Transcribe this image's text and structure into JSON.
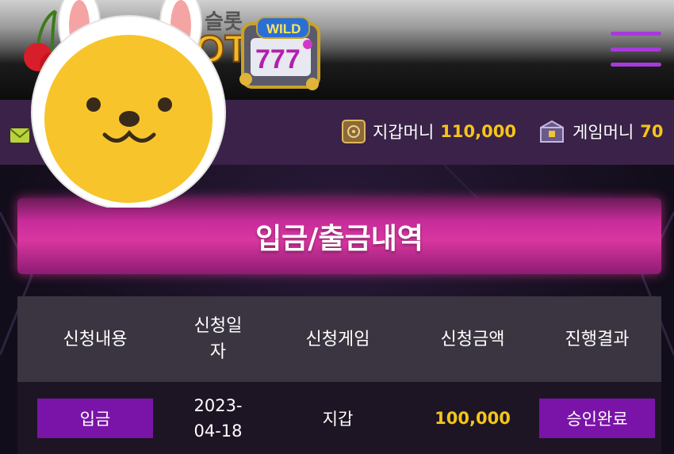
{
  "header": {
    "logo_label": "슬롯",
    "logo_badge": "WILD",
    "logo_reels": "777"
  },
  "infobar": {
    "wallet_label": "지갑머니",
    "wallet_amount": "110,000",
    "game_label": "게임머니",
    "game_amount": "70"
  },
  "page": {
    "title": "입금/출금내역"
  },
  "table": {
    "headers": [
      "신청내용",
      "신청일자",
      "신청게임",
      "신청금액",
      "진행결과"
    ],
    "rows": [
      {
        "type": "입금",
        "date_line1": "2023-",
        "date_line2": "04-18",
        "game": "지갑",
        "amount": "100,000",
        "status": "승인완료"
      }
    ]
  },
  "colors": {
    "accent_purple": "#7a14a8",
    "amount_gold": "#f5c518",
    "title_pink": "#d9369f"
  },
  "icons": {
    "menu": "hamburger-icon",
    "mail": "mail-icon",
    "wallet": "safe-icon",
    "game": "treasure-chest-icon",
    "mascot": "bunny-mascot"
  }
}
